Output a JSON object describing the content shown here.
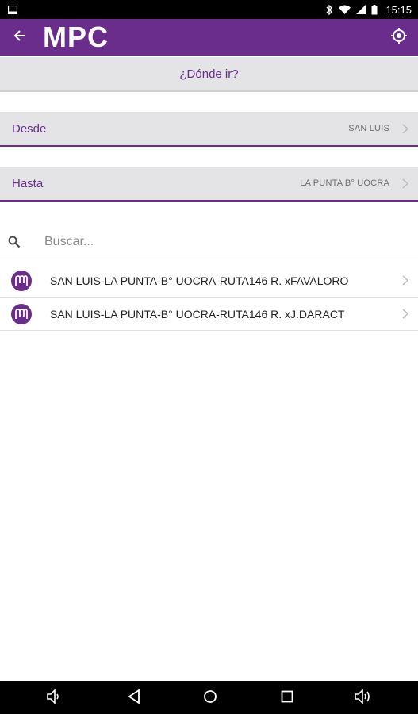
{
  "status_bar": {
    "time": "15:15",
    "icons": [
      "tablet-icon",
      "bluetooth-icon",
      "wifi-icon",
      "no-signal-icon",
      "battery-icon"
    ]
  },
  "app_bar": {
    "title": "MPC",
    "back_icon": "arrow-back-icon",
    "locate_icon": "my-location-icon",
    "color": "#6a2d8c"
  },
  "where_header": {
    "label": "¿Dónde ir?"
  },
  "from": {
    "label": "Desde",
    "value": "SAN LUIS"
  },
  "to": {
    "label": "Hasta",
    "value": "LA PUNTA B° UOCRA"
  },
  "search": {
    "placeholder": "Buscar...",
    "value": ""
  },
  "routes": [
    {
      "name": "SAN LUIS-LA PUNTA-B° UOCRA-RUTA146 R. xFAVALORO"
    },
    {
      "name": "SAN LUIS-LA PUNTA-B° UOCRA-RUTA146 R. xJ.DARACT"
    }
  ],
  "nav_bar": {
    "buttons": [
      "volume-down-icon",
      "back-icon",
      "home-icon",
      "recents-icon",
      "volume-up-icon"
    ]
  }
}
